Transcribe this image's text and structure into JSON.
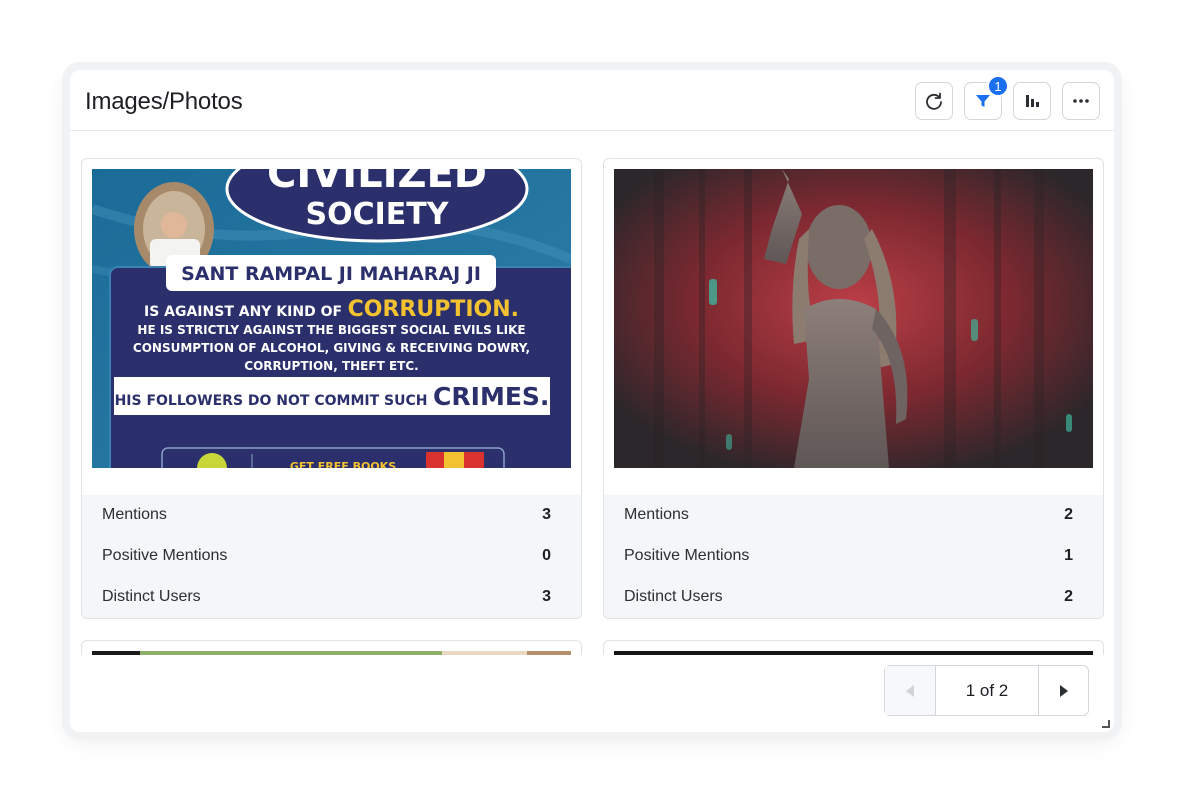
{
  "widget": {
    "title": "Images/Photos",
    "filter_badge": "1",
    "icons": [
      "refresh-icon",
      "filter-icon",
      "bar-chart-icon",
      "more-icon"
    ]
  },
  "cards": [
    {
      "poster": {
        "society": "SOCIETY",
        "civilized": "CIVILIZED",
        "name": "SANT RAMPAL JI MAHARAJ JI",
        "line1_pre": "IS AGAINST ANY KIND OF",
        "line1_emph": "CORRUPTION.",
        "line2": "HE IS STRICTLY AGAINST THE BIGGEST SOCIAL EVILS LIKE",
        "line3": "CONSUMPTION OF ALCOHOL, GIVING & RECEIVING DOWRY,",
        "line4": "CORRUPTION, THEFT ETC.",
        "line5_pre": "HIS FOLLOWERS DO NOT COMMIT SUCH",
        "line5_emph": "CRIMES.",
        "books": "GET FREE BOOKS"
      },
      "stats": [
        {
          "label": "Mentions",
          "value": "3"
        },
        {
          "label": "Positive Mentions",
          "value": "0"
        },
        {
          "label": "Distinct Users",
          "value": "3"
        }
      ]
    },
    {
      "stats": [
        {
          "label": "Mentions",
          "value": "2"
        },
        {
          "label": "Positive Mentions",
          "value": "1"
        },
        {
          "label": "Distinct Users",
          "value": "2"
        }
      ]
    }
  ],
  "pagination": {
    "label": "1 of 2"
  },
  "colors": {
    "accent": "#1d6ff2",
    "poster_navy": "#2b2f6b",
    "poster_gold": "#f2c230"
  }
}
